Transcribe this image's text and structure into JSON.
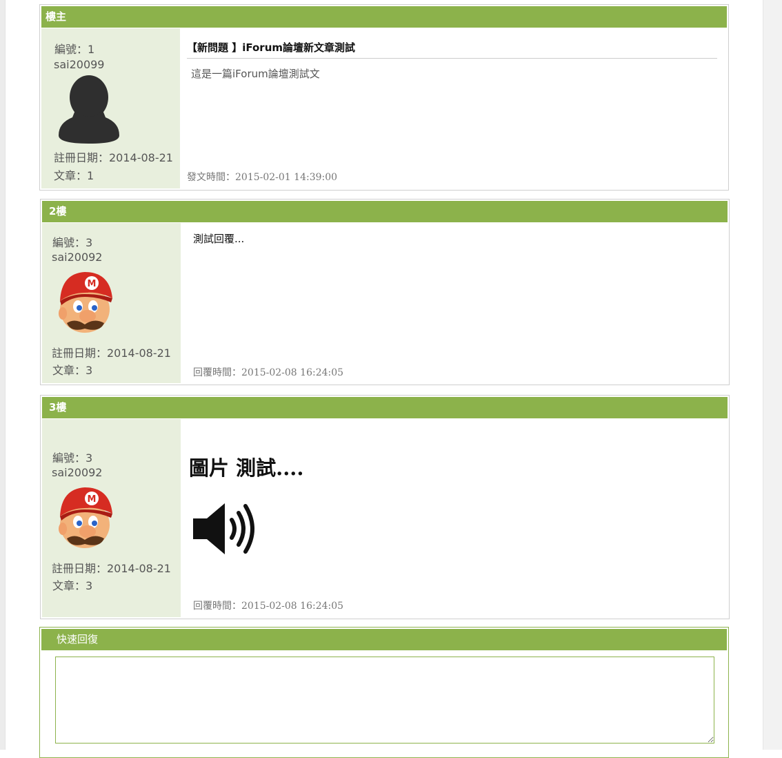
{
  "posts": [
    {
      "floor": "樓主",
      "user_no": "編號：1",
      "username": "sai20099",
      "avatar": "default-user-silhouette",
      "reg_date": "註冊日期：2014-08-21",
      "post_count": "文章：1",
      "title": "【新問題 】iForum論壇新文章測試",
      "body": "這是一篇iForum論壇測試文",
      "time": "發文時間：2015-02-01 14:39:00"
    },
    {
      "floor": "2樓",
      "user_no": "編號：3",
      "username": "sai20092",
      "avatar": "mario-face",
      "reg_date": "註冊日期：2014-08-21",
      "post_count": "文章：3",
      "body": "測試回覆...",
      "time": "回覆時間：2015-02-08 16:24:05"
    },
    {
      "floor": "3樓",
      "user_no": "編號：3",
      "username": "sai20092",
      "avatar": "mario-face",
      "reg_date": "註冊日期：2014-08-21",
      "post_count": "文章：3",
      "body": "圖片 測試....",
      "image": "speaker-icon",
      "time": "回覆時間：2015-02-08 16:24:05"
    }
  ],
  "quick_reply": {
    "title": "快速回復",
    "value": "",
    "placeholder": ""
  },
  "colors": {
    "header_green": "#8cb24b",
    "userinfo_bg": "#e8efdd"
  }
}
